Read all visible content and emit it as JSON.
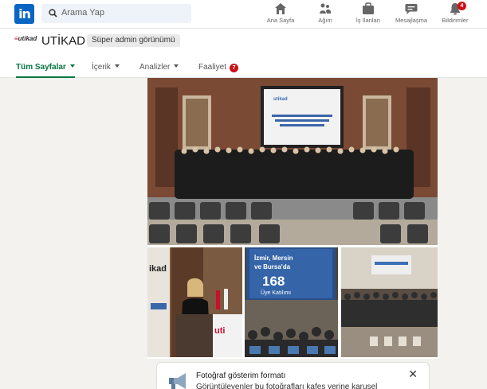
{
  "nav": {
    "logo": "in",
    "search_placeholder": "Arama Yap",
    "items": [
      {
        "label": "Ana Sayfa",
        "icon": "home-icon"
      },
      {
        "label": "Ağım",
        "icon": "network-icon"
      },
      {
        "label": "İş İlanları",
        "icon": "jobs-icon"
      },
      {
        "label": "Mesajlaşma",
        "icon": "messaging-icon"
      },
      {
        "label": "Bildirimler",
        "icon": "bell-icon",
        "badge": "4"
      }
    ]
  },
  "page": {
    "logo_text": "utikad",
    "name": "UTİKAD",
    "role": "Süper admin görünümü",
    "tabs": [
      {
        "label": "Tüm Sayfalar",
        "active": true,
        "dropdown": true
      },
      {
        "label": "İçerik",
        "dropdown": true
      },
      {
        "label": "Analizler",
        "dropdown": true
      },
      {
        "label": "Faaliyet",
        "count": "7"
      }
    ]
  },
  "photos": {
    "screen_title": "FIATA DİPLOMA EĞİTİMİ VE UTİKAD LOJİSTİK EĞİTİM MEZUNİYET TÖRENİ",
    "screen_logo": "utikad",
    "banner_name": "ikad",
    "lectern_logo": "uti",
    "stat_line1": "İzmir, Mersin",
    "stat_line2": "ve Bursa'da",
    "stat_number": "168",
    "stat_line3": "Üye Katılımı"
  },
  "notice": {
    "title": "Fotoğraf gösterim formatı",
    "body": "Görüntüleyenler bu fotoğrafları kafes yerine karusel",
    "close": "✕"
  },
  "colors": {
    "brand": "#0a66c2",
    "active_tab": "#057642",
    "badge": "#cc1016"
  }
}
